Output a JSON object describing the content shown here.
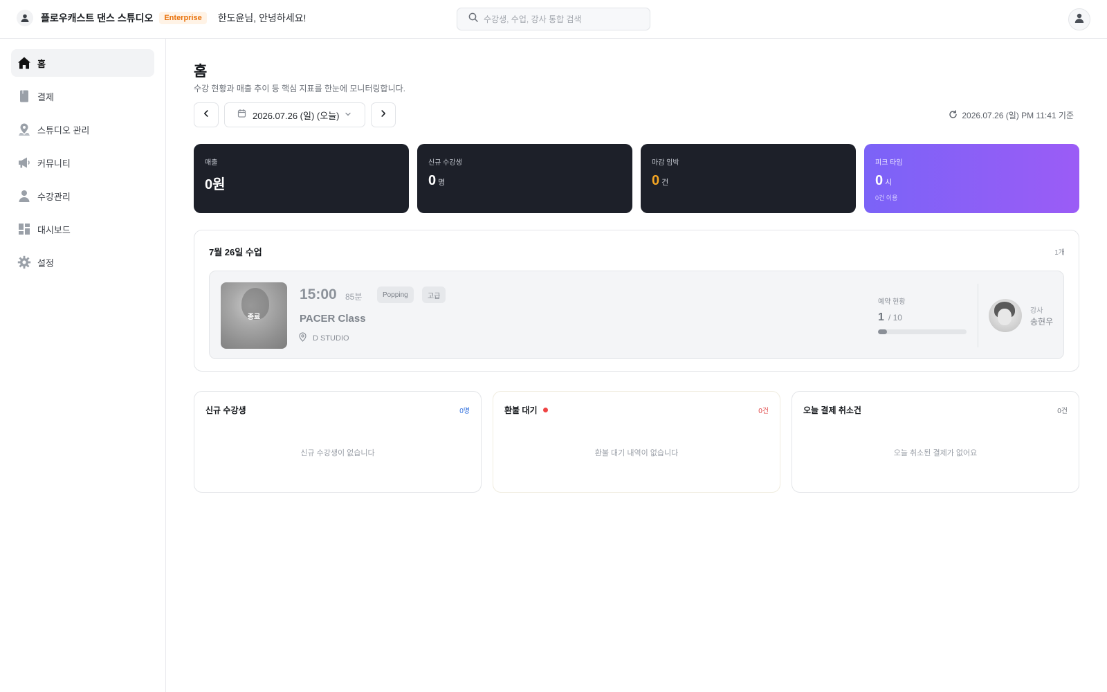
{
  "header": {
    "studio_name": "플로우캐스트 댄스 스튜디오",
    "plan_badge": "Enterprise",
    "greeting": "한도윤님, 안녕하세요!",
    "search_placeholder": "수강생, 수업, 강사 통합 검색"
  },
  "sidebar": {
    "items": [
      {
        "label": "홈",
        "icon": "home-icon",
        "active": true
      },
      {
        "label": "결제",
        "icon": "receipt-icon",
        "active": false
      },
      {
        "label": "스튜디오 관리",
        "icon": "location-pin-icon",
        "active": false
      },
      {
        "label": "커뮤니티",
        "icon": "megaphone-icon",
        "active": false
      },
      {
        "label": "수강관리",
        "icon": "person-icon",
        "active": false
      },
      {
        "label": "대시보드",
        "icon": "dashboard-icon",
        "active": false
      },
      {
        "label": "설정",
        "icon": "gear-icon",
        "active": false
      }
    ]
  },
  "page": {
    "title": "홈",
    "description": "수강 현황과 매출 추이 등 핵심 지표를 한눈에 모니터링합니다.",
    "date_label": "2026.07.26 (일) (오늘)",
    "updated_at": "2026.07.26 (일) PM 11:41 기준"
  },
  "stats": [
    {
      "label": "매출",
      "value": "0원",
      "unit": ""
    },
    {
      "label": "신규 수강생",
      "value": "0",
      "unit": "명"
    },
    {
      "label": "마감 임박",
      "value": "0",
      "unit": "건",
      "accent": "#f5a623"
    },
    {
      "label": "피크 타임",
      "value": "0",
      "unit": "시",
      "sub": "0건 이용"
    }
  ],
  "classes": {
    "title": "7월 26일 수업",
    "count": "1개",
    "items": [
      {
        "status": "종료",
        "time": "15:00",
        "duration": "85분",
        "genre": "Popping",
        "level": "고급",
        "name": "PACER Class",
        "location": "D STUDIO",
        "reservation_label": "예약 현황",
        "reserved": "1",
        "capacity": "/ 10",
        "reserved_fraction": 0.1,
        "instructor_label": "강사",
        "instructor_name": "송현우"
      }
    ]
  },
  "panels": {
    "new_students": {
      "title": "신규 수강생",
      "count": "0명",
      "empty": "신규 수강생이 없습니다",
      "color": "#2f6fde"
    },
    "refund": {
      "title": "환불 대기",
      "count": "0건",
      "empty": "환불 대기 내역이 없습니다",
      "color": "#e04848"
    },
    "cancellations": {
      "title": "오늘 결제 취소건",
      "count": "0건",
      "empty": "오늘 취소된 결제가 없어요",
      "color": "#6b7078"
    }
  }
}
